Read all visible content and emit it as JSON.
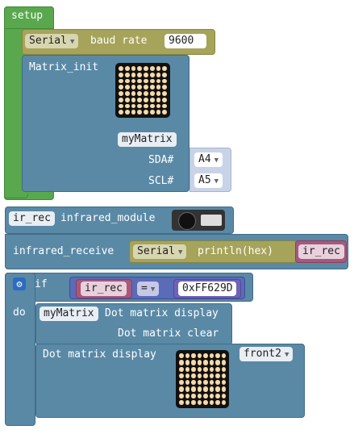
{
  "setup": {
    "label": "setup",
    "serial_dropdown": "Serial",
    "baud_label": "baud rate",
    "baud_value": "9600",
    "matrix_init_label": "Matrix_init",
    "matrix_name": "myMatrix",
    "sda_label": "SDA#",
    "sda_value": "A4",
    "scl_label": "SCL#",
    "scl_value": "A5"
  },
  "ir": {
    "var_name": "ir_rec",
    "module_label": "infrared_module",
    "receive_label": "infrared_receive",
    "serial_dropdown": "Serial",
    "println_label": "println(hex)",
    "println_arg": "ir_rec"
  },
  "if_block": {
    "if_label": "if",
    "do_label": "do",
    "compare_var": "ir_rec",
    "operator": "=",
    "value": "0xFF629D"
  },
  "matrix_actions": {
    "target_name": "myMatrix",
    "display_label": "Dot matrix display",
    "clear_label": "Dot matrix clear",
    "display2_label": "Dot matrix display",
    "font_value": "front2"
  },
  "colors": {
    "green": "#59a84e",
    "blue": "#5a89a6",
    "olive": "#a6a35a",
    "maroon": "#a5597c",
    "purple": "#6e63b7"
  }
}
